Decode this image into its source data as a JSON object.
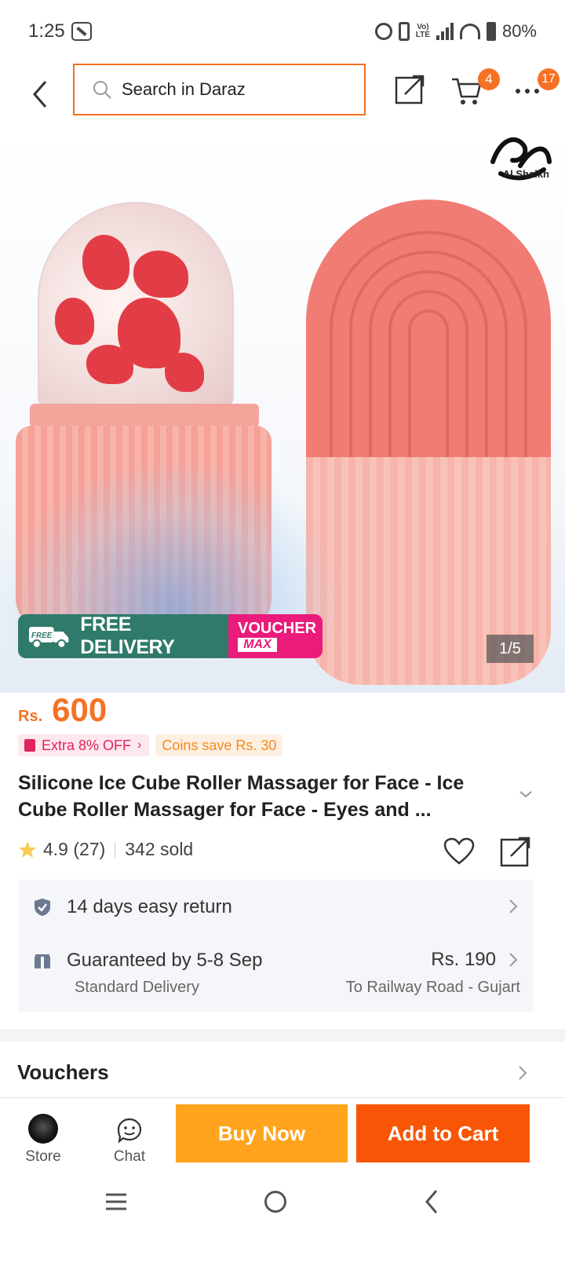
{
  "status_bar": {
    "time": "1:25",
    "battery": "80%",
    "network": "4G",
    "volte": "VoLTE"
  },
  "header": {
    "search_placeholder": "Search in Daraz",
    "cart_count": "4",
    "notifications_count": "17"
  },
  "gallery": {
    "brand_logo_text": "Al Shaikh",
    "delivery_label": "FREE DELIVERY",
    "free_tag": "FREE",
    "voucher_label": "VOUCHER",
    "voucher_max": "MAX",
    "image_counter": "1/5"
  },
  "product": {
    "currency": "Rs.",
    "price": "600",
    "promo_label": "Extra 8% OFF",
    "coins_label": "Coins save Rs. 30",
    "title": "Silicone Ice Cube Roller Massager for Face - Ice Cube Roller Massager for Face - Eyes and ...",
    "rating": "4.9 (27)",
    "sold": "342 sold"
  },
  "services": {
    "return_label": "14 days easy return",
    "delivery_label": "Guaranteed by 5-8 Sep",
    "delivery_fee": "Rs. 190",
    "delivery_type": "Standard Delivery",
    "delivery_to": "To Railway Road - Gujart"
  },
  "vouchers": {
    "title": "Vouchers"
  },
  "action_bar": {
    "store_label": "Store",
    "chat_label": "Chat",
    "buy_now_label": "Buy Now",
    "add_to_cart_label": "Add to Cart"
  },
  "colors": {
    "accent": "#f57224",
    "buy_now": "#ffa41c",
    "add_to_cart": "#f85606",
    "promo_pink": "#e0245e",
    "delivery_green": "#2f7a6a",
    "voucher_pink": "#ea1b7a"
  }
}
